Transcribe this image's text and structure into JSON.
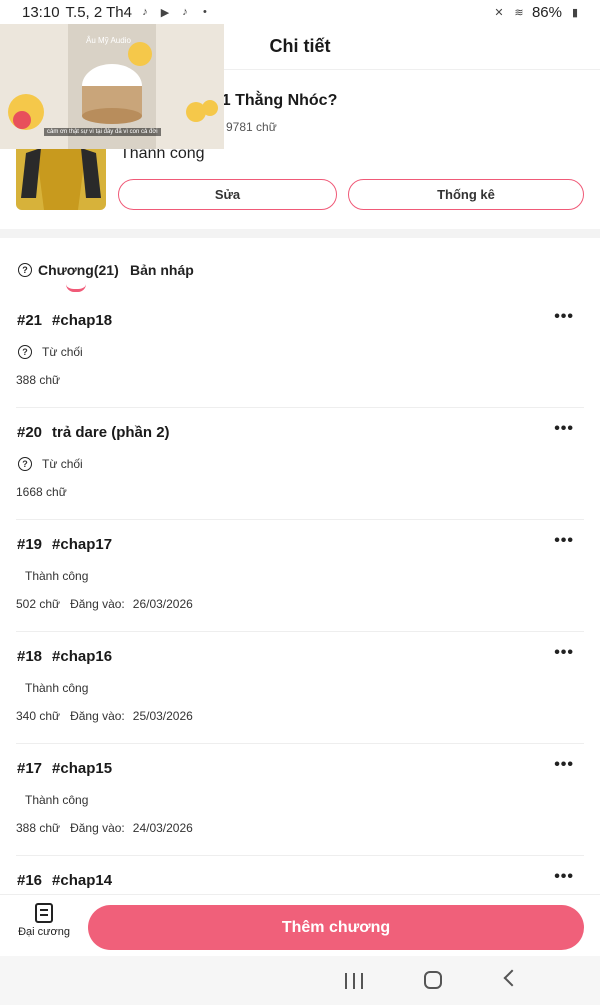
{
  "status_bar": {
    "time": "13:10",
    "date": "T.5, 2 Th4",
    "battery": "86%"
  },
  "header": {
    "title": "Chi tiết"
  },
  "book": {
    "title": "ayer] Lỡ Yêu 1 Thằng Nhóc?",
    "words": "9781 chữ",
    "status": "Thành công",
    "edit_label": "Sửa",
    "stats_label": "Thống kê"
  },
  "tabs": {
    "chapters": "Chương(21)",
    "drafts": "Bản nháp"
  },
  "chapters": [
    {
      "num": "#21",
      "title": "#chap18",
      "status": "Từ chối",
      "words": "388 chữ",
      "posted_label": "",
      "posted_date": ""
    },
    {
      "num": "#20",
      "title": "trả dare (phần 2)",
      "status": "Từ chối",
      "words": "1668 chữ",
      "posted_label": "",
      "posted_date": ""
    },
    {
      "num": "#19",
      "title": "#chap17",
      "status": "Thành công",
      "words": "502 chữ",
      "posted_label": "Đăng vào:",
      "posted_date": "26/03/2026"
    },
    {
      "num": "#18",
      "title": "#chap16",
      "status": "Thành công",
      "words": "340 chữ",
      "posted_label": "Đăng vào:",
      "posted_date": "25/03/2026"
    },
    {
      "num": "#17",
      "title": "#chap15",
      "status": "Thành công",
      "words": "388 chữ",
      "posted_label": "Đăng vào:",
      "posted_date": "24/03/2026"
    },
    {
      "num": "#16",
      "title": "#chap14",
      "status": "",
      "words": "",
      "posted_label": "",
      "posted_date": ""
    }
  ],
  "more_glyph": "•••",
  "bottom": {
    "outline_label": "Đại cương",
    "add_chapter_label": "Thêm chương"
  },
  "video": {
    "label": "Âu Mỹ Audio",
    "caption": "cảm ơn thật sự vì tại đây đã vì con cả đời"
  },
  "colors": {
    "accent": "#f05a78",
    "add_button": "#f0607a"
  }
}
